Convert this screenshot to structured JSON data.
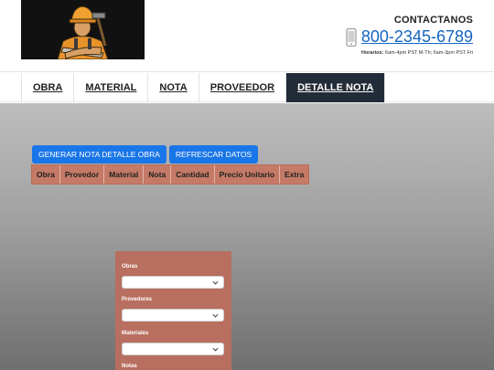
{
  "header": {
    "contact_label": "CONTACTANOS",
    "phone": "800-2345-6789",
    "hours_label": "Horarios:",
    "hours_text": "6am-4pm PST M-Th; 6am-3pm PST Fri"
  },
  "nav": {
    "items": [
      {
        "label": "OBRA"
      },
      {
        "label": "MATERIAL"
      },
      {
        "label": "NOTA"
      },
      {
        "label": "PROVEEDOR"
      },
      {
        "label": "DETALLE NOTA",
        "active": true
      }
    ]
  },
  "actions": {
    "generate_label": "GENERAR NOTA DETALLE OBRA",
    "refresh_label": "REFRESCAR DATOS"
  },
  "table": {
    "headers": [
      "Obra",
      "Provedor",
      "Material",
      "Nota",
      "Cantidad",
      "Precio Unitario",
      "Extra"
    ]
  },
  "form": {
    "obras_label": "Obras",
    "proveedores_label": "Provedores",
    "materiales_label": "Materiales",
    "notas_label": "Notas"
  },
  "colors": {
    "accent": "#1976e8",
    "nav_active": "#222b38",
    "table_header": "#c47a66",
    "form_panel": "#b86f5f",
    "phone_link": "#1565c0"
  },
  "icons": {
    "logo": "construction-worker-logo",
    "phone": "mobile-phone-icon",
    "chevron": "chevron-down-icon"
  }
}
